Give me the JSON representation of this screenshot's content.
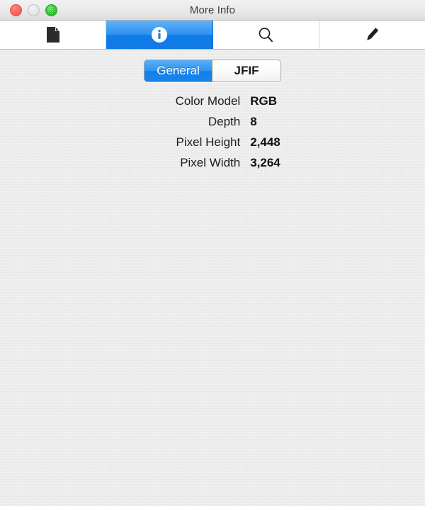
{
  "window": {
    "title": "More Info",
    "controls": [
      {
        "name": "close",
        "icon": "close-traffic-light",
        "enabled": true
      },
      {
        "name": "minimize",
        "icon": "minimize-traffic-light",
        "enabled": false
      },
      {
        "name": "zoom",
        "icon": "zoom-traffic-light",
        "enabled": true
      }
    ]
  },
  "toolbar": {
    "tabs": [
      {
        "id": "file",
        "icon": "document-icon",
        "label": "File",
        "selected": false
      },
      {
        "id": "info",
        "icon": "info-circle-icon",
        "label": "Info",
        "selected": true
      },
      {
        "id": "search",
        "icon": "search-icon",
        "label": "Search",
        "selected": false
      },
      {
        "id": "edit",
        "icon": "pencil-icon",
        "label": "Edit",
        "selected": false
      }
    ],
    "selected_tab": "info"
  },
  "segmented_control": {
    "selected": "General",
    "segments": [
      {
        "label": "General",
        "selected": true
      },
      {
        "label": "JFIF",
        "selected": false
      }
    ]
  },
  "info_panel": {
    "rows": [
      {
        "label": "Color Model",
        "value": "RGB"
      },
      {
        "label": "Depth",
        "value": "8"
      },
      {
        "label": "Pixel Height",
        "value": "2,448"
      },
      {
        "label": "Pixel Width",
        "value": "3,264"
      }
    ]
  },
  "colors": {
    "accent_blue": "#1280ea",
    "titlebar_top": "#f2f1f2",
    "titlebar_bottom": "#dedcde",
    "content_bg": "#e9e9e9",
    "close_red": "#ef5349",
    "zoom_green": "#21b32a",
    "minimize_gray": "#dcdbdb"
  }
}
